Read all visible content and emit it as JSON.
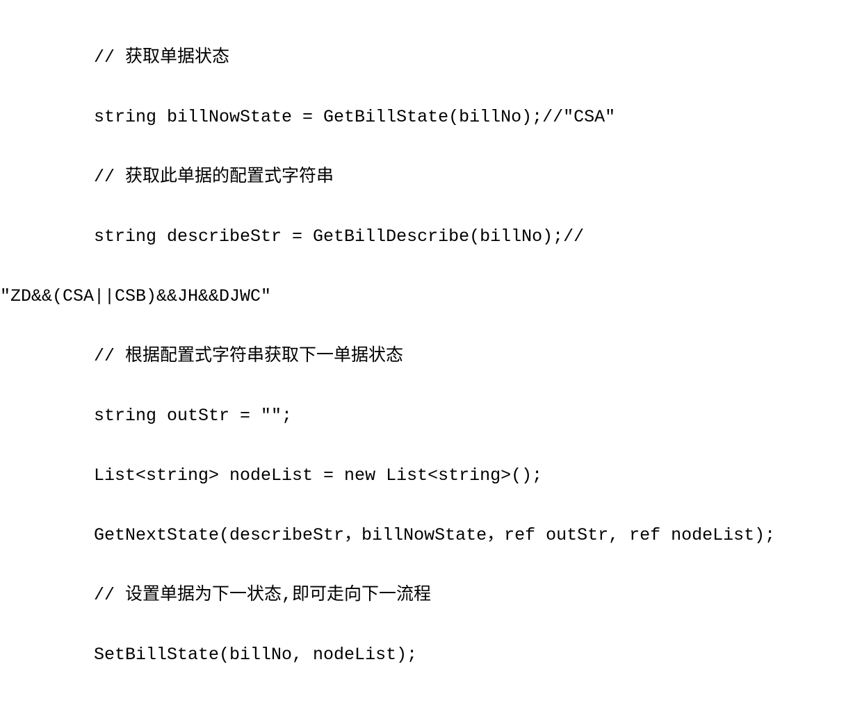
{
  "code": {
    "line1": "// 获取单据状态",
    "line2": "string billNowState = GetBillState(billNo);//\"CSA\"",
    "line3": "// 获取此单据的配置式字符串",
    "line4": "string describeStr = GetBillDescribe(billNo);//",
    "line5": "\"ZD&&(CSA||CSB)&&JH&&DJWC\"",
    "line6": "// 根据配置式字符串获取下一单据状态",
    "line7": "string outStr = \"\";",
    "line8": "List<string> nodeList = new List<string>();",
    "line9": "GetNextState(describeStr，billNowState，ref outStr, ref nodeList);",
    "line10": "// 设置单据为下一状态,即可走向下一流程",
    "line11": "SetBillState(billNo, nodeList);"
  }
}
